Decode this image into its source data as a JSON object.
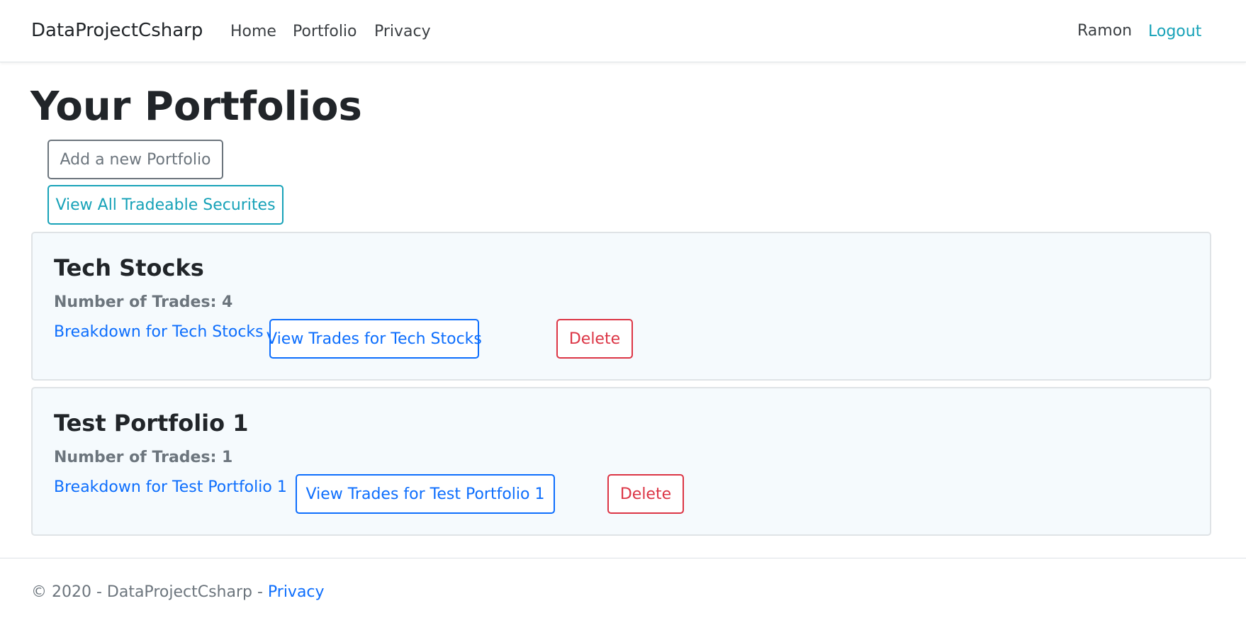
{
  "navbar": {
    "brand": "DataProjectCsharp",
    "links": [
      "Home",
      "Portfolio",
      "Privacy"
    ],
    "user": "Ramon",
    "logout": "Logout"
  },
  "page": {
    "title": "Your Portfolios",
    "add_button": "Add a new Portfolio",
    "securities_button": "View All Tradeable Securites"
  },
  "portfolios": [
    {
      "name": "Tech Stocks",
      "trades_label": "Number of Trades: 4",
      "breakdown_link": "Breakdown for Tech Stocks",
      "view_trades_button": "View Trades for Tech Stocks",
      "delete_button": "Delete"
    },
    {
      "name": "Test Portfolio 1",
      "trades_label": "Number of Trades: 1",
      "breakdown_link": "Breakdown for Test Portfolio 1",
      "view_trades_button": "View Trades for Test Portfolio 1",
      "delete_button": "Delete"
    }
  ],
  "footer": {
    "text": "© 2020 - DataProjectCsharp - ",
    "privacy_link": "Privacy"
  },
  "colors": {
    "link": "#0d6efd",
    "info": "#17a2b8",
    "danger": "#dc3545",
    "secondary": "#6c757d",
    "card_bg": "#f5fafd"
  }
}
